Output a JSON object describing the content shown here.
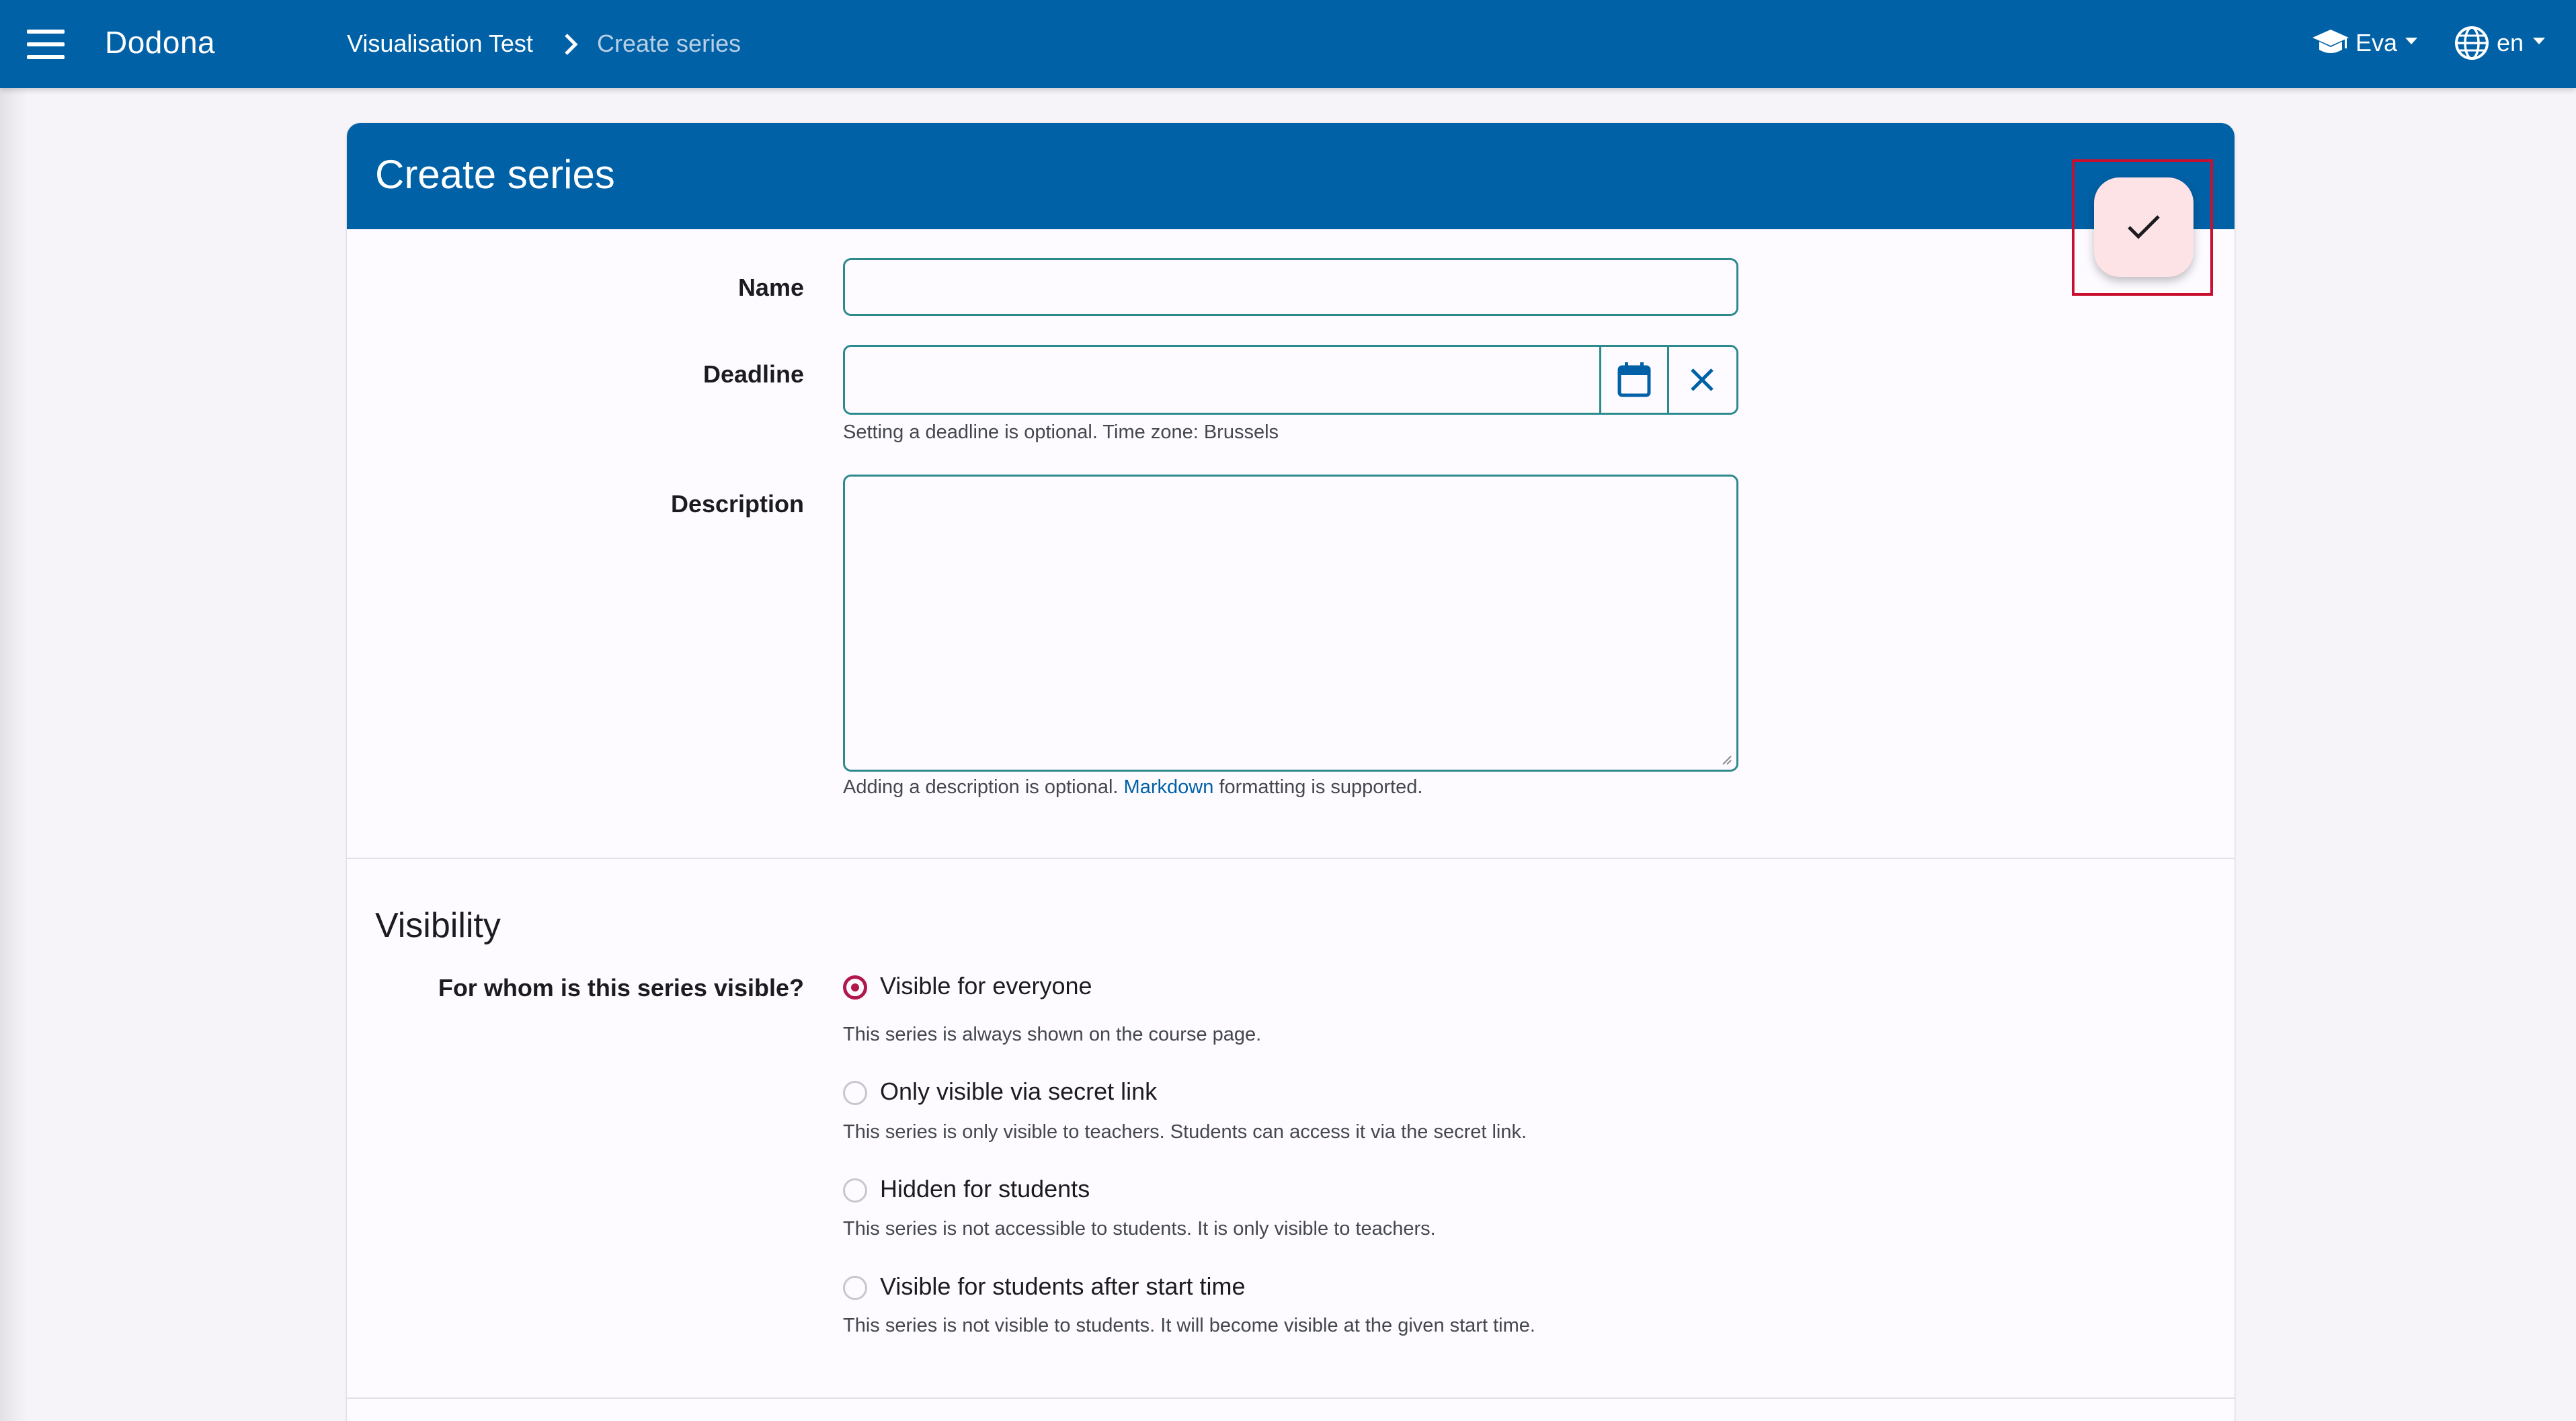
{
  "navbar": {
    "brand": "Dodona",
    "breadcrumb": [
      "Visualisation Test",
      "Create series"
    ],
    "user": "Eva",
    "language": "en"
  },
  "page": {
    "title": "Create series"
  },
  "form": {
    "name": {
      "label": "Name",
      "value": ""
    },
    "deadline": {
      "label": "Deadline",
      "value": "",
      "help": "Setting a deadline is optional. Time zone: Brussels"
    },
    "description": {
      "label": "Description",
      "value": "",
      "help_prefix": "Adding a description is optional.",
      "help_link": "Markdown",
      "help_suffix": "formatting is supported."
    }
  },
  "visibility": {
    "section_title": "Visibility",
    "question": "For whom is this series visible?",
    "selected": "Visible for everyone",
    "options": [
      {
        "label": "Visible for everyone",
        "help": "This series is always shown on the course page.",
        "checked": true
      },
      {
        "label": "Only visible via secret link",
        "help": "This series is only visible to teachers. Students can access it via the secret link.",
        "checked": false
      },
      {
        "label": "Hidden for students",
        "help": "This series is not accessible to students. It is only visible to teachers.",
        "checked": false
      },
      {
        "label": "Visible for students after start time",
        "help": "This series is not visible to students. It will become visible at the given start time.",
        "checked": false
      }
    ]
  },
  "icons": {
    "menu": "hamburger-menu-icon",
    "breadcrumb_separator": "chevron-right-icon",
    "user": "graduation-cap-icon",
    "language": "globe-icon",
    "calendar": "calendar-icon",
    "clear": "close-icon",
    "save": "check-icon"
  },
  "colors": {
    "primary": "#0061a6",
    "accent": "#b0174b",
    "fab_bg": "#fde2e6",
    "input_border": "#2d8a8c"
  }
}
